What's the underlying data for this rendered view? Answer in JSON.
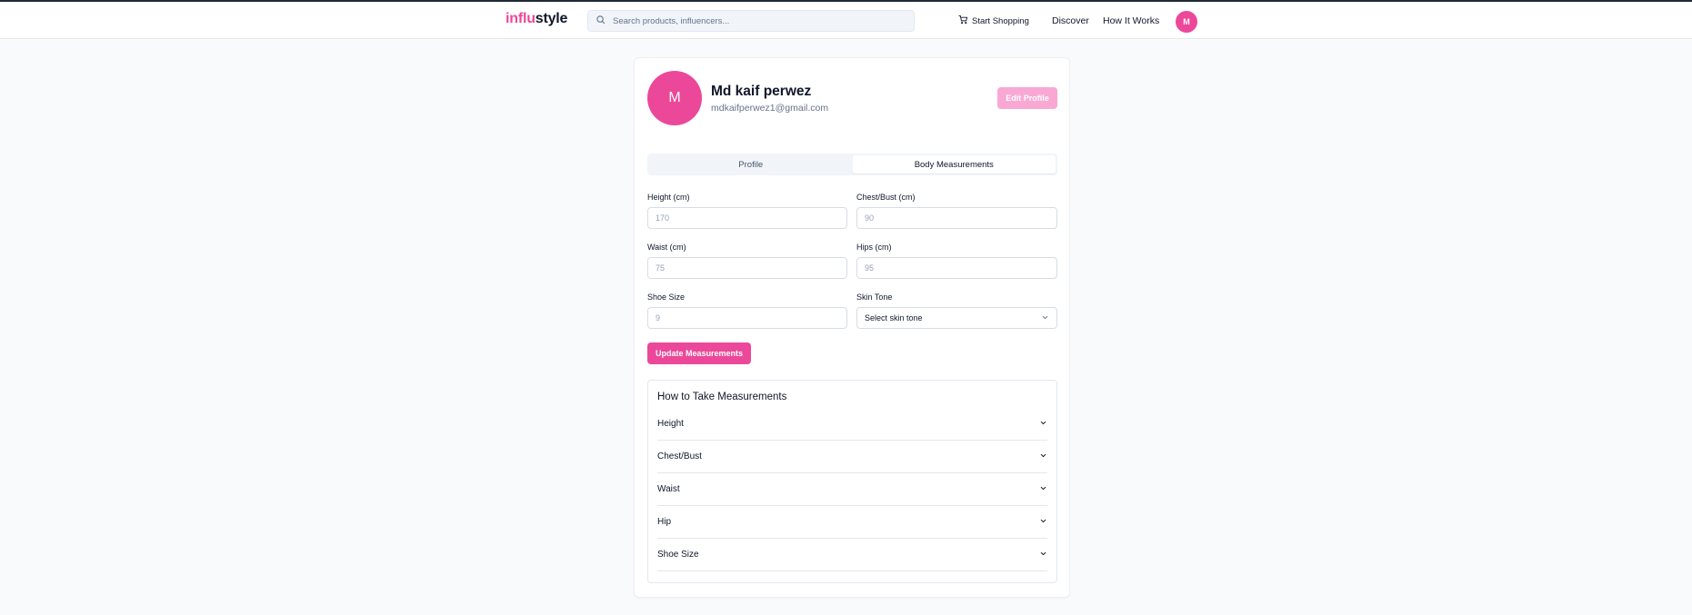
{
  "header": {
    "logo_accent": "influ",
    "logo_rest": "style",
    "search_placeholder": "Search products, influencers...",
    "start_shopping": "Start Shopping",
    "discover": "Discover",
    "how_it_works": "How It Works",
    "avatar_initial": "M",
    "icons": {
      "search": "search-icon",
      "cart": "cart-icon"
    }
  },
  "profile": {
    "avatar_initial": "M",
    "name": "Md kaif perwez",
    "email": "mdkaifperwez1@gmail.com",
    "edit_label": "Edit Profile"
  },
  "tabs": [
    {
      "label": "Profile",
      "active": false
    },
    {
      "label": "Body Measurements",
      "active": true
    }
  ],
  "form": {
    "height": {
      "label": "Height (cm)",
      "placeholder": "170"
    },
    "chest": {
      "label": "Chest/Bust (cm)",
      "placeholder": "90"
    },
    "waist": {
      "label": "Waist (cm)",
      "placeholder": "75"
    },
    "hips": {
      "label": "Hips (cm)",
      "placeholder": "95"
    },
    "shoe": {
      "label": "Shoe Size",
      "placeholder": "9"
    },
    "skin": {
      "label": "Skin Tone",
      "value": "Select skin tone"
    },
    "update_label": "Update Measurements"
  },
  "guide": {
    "title": "How to Take Measurements",
    "items": [
      {
        "label": "Height"
      },
      {
        "label": "Chest/Bust"
      },
      {
        "label": "Waist"
      },
      {
        "label": "Hip"
      },
      {
        "label": "Shoe Size"
      }
    ]
  },
  "colors": {
    "accent": "#ec4899",
    "accent_light": "#f9a8d4",
    "background": "#f8fafc"
  }
}
